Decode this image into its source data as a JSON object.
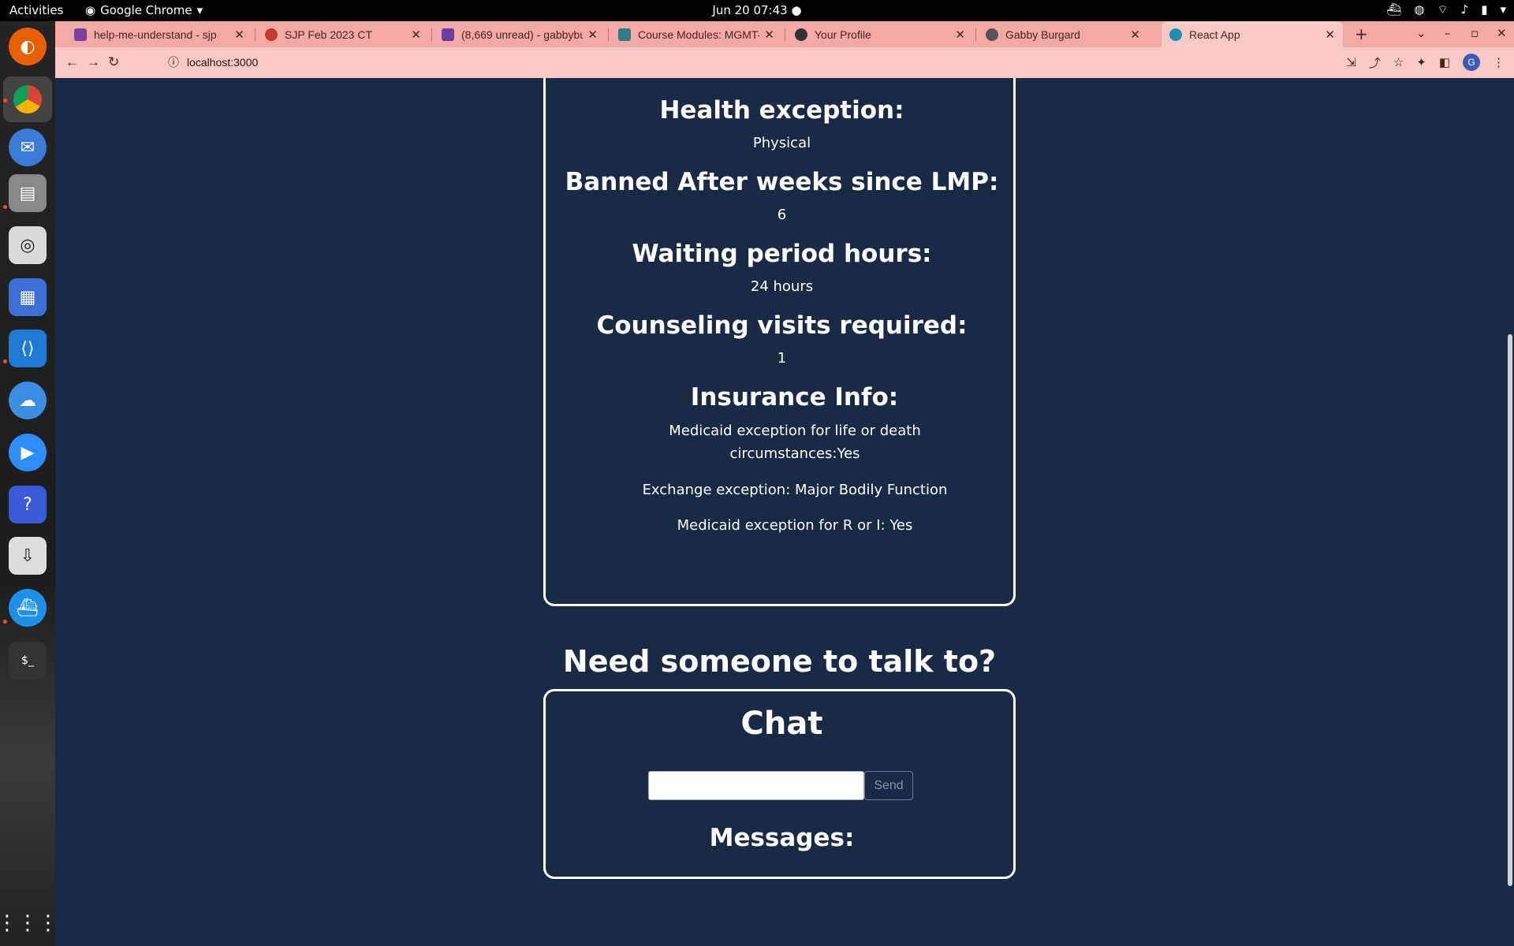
{
  "topbar": {
    "activities": "Activities",
    "app_name": "Google Chrome",
    "clock": "Jun 20  07:43"
  },
  "browser": {
    "tabs": [
      {
        "title": "help-me-understand - sjp",
        "color": "#7b3fa0"
      },
      {
        "title": "SJP Feb 2023 CT",
        "color": "#c0392b"
      },
      {
        "title": "(8,669 unread) - gabbybu",
        "color": "#6a3fa8"
      },
      {
        "title": "Course Modules: MGMT-",
        "color": "#2f7f8a"
      },
      {
        "title": "Your Profile",
        "color": "#333333"
      },
      {
        "title": "Gabby Burgard",
        "color": "#555555"
      },
      {
        "title": "React App",
        "color": "#1e8fb0"
      }
    ],
    "active_tab_index": 6,
    "url": "localhost:3000",
    "profile_initial": "G"
  },
  "info_card": {
    "health_exception_label": "Health exception:",
    "health_exception_value": "Physical",
    "banned_after_label": "Banned After weeks since LMP:",
    "banned_after_value": "6",
    "waiting_period_label": "Waiting period hours:",
    "waiting_period_value": "24 hours",
    "counseling_label": "Counseling visits required:",
    "counseling_value": "1",
    "insurance_label": "Insurance Info:",
    "insurance_items": [
      "Medicaid exception for life or death circumstances:Yes",
      "Exchange exception: Major Bodily Function",
      "Medicaid exception for R or I: Yes"
    ]
  },
  "talk_heading": "Need someone to talk to?",
  "chat": {
    "title": "Chat",
    "input_value": "",
    "send_label": "Send",
    "messages_label": "Messages:"
  },
  "colors": {
    "page_bg": "#1b2a44",
    "chrome_tabstrip": "#f2a8a4",
    "chrome_toolbar": "#f8c9c6"
  }
}
